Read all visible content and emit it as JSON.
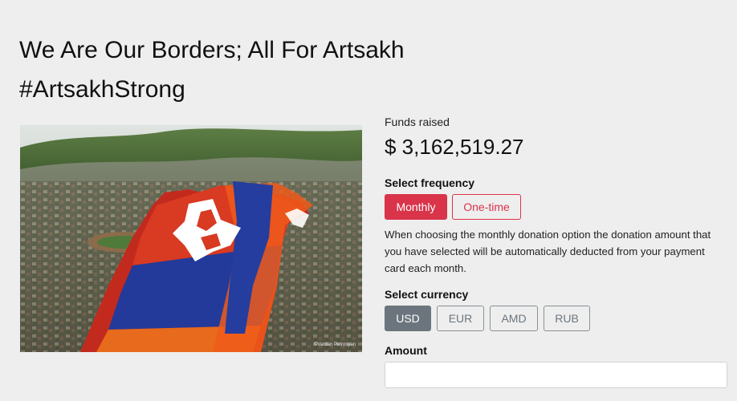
{
  "campaign": {
    "title": "We Are Our Borders; All For Artsakh #ArtsakhStrong",
    "image_alt": "Artsakh flag over city",
    "image_credit": "©Vardan Petrosyan"
  },
  "funds": {
    "label": "Funds raised",
    "amount": "$ 3,162,519.27"
  },
  "frequency": {
    "label": "Select frequency",
    "options": [
      "Monthly",
      "One-time"
    ],
    "selected": "Monthly",
    "note": "When choosing the monthly donation option the donation amount that you have selected will be automatically deducted from your payment card each month."
  },
  "currency": {
    "label": "Select currency",
    "options": [
      "USD",
      "EUR",
      "AMD",
      "RUB"
    ],
    "selected": "USD"
  },
  "amount": {
    "label": "Amount",
    "value": "",
    "placeholder": ""
  },
  "colors": {
    "accent": "#d9344a",
    "secondary": "#6c757d",
    "background": "#eeeeee"
  }
}
